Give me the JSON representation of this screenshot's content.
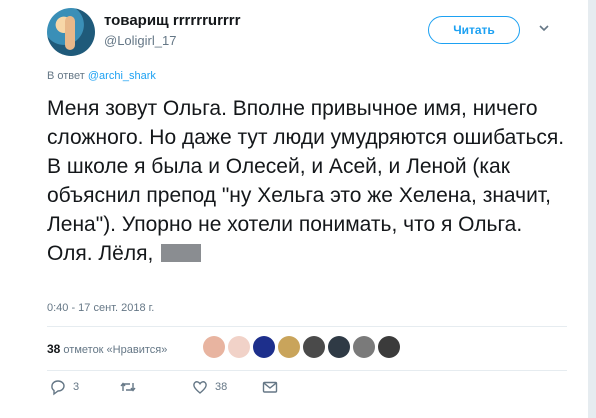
{
  "user": {
    "display_name": "товарищ rrrrrrurrrr",
    "handle": "@Loligirl_17"
  },
  "follow_button": {
    "label": "Читать"
  },
  "reply_to": {
    "prefix": "В ответ",
    "handle": "@archi_shark"
  },
  "tweet": {
    "text": "Меня зовут Ольга. Вполне привычное имя, ничего сложного. Но даже тут люди умудряются ошибаться. В школе я была и Олесей, и Асей, и Леной (как объяснил препод \"ну Хельга это же Хелена, значит, Лена\"). Упорно не хотели понимать, что я Ольга. Оля. Лёля, ",
    "timestamp": "0:40 - 17 сент. 2018 г."
  },
  "likes": {
    "count": "38",
    "label": "отметок «Нравится»"
  },
  "likers": [
    {
      "name": "liker-1",
      "color": "#e8b4a0"
    },
    {
      "name": "liker-2",
      "color": "#f1d2c8"
    },
    {
      "name": "liker-3",
      "color": "#1d2f8c"
    },
    {
      "name": "liker-4",
      "color": "#c9a45b"
    },
    {
      "name": "liker-5",
      "color": "#4a4a4a"
    },
    {
      "name": "liker-6",
      "color": "#2f3a45"
    },
    {
      "name": "liker-7",
      "color": "#7a7a7a"
    },
    {
      "name": "liker-8",
      "color": "#3b3b3b"
    }
  ],
  "actions": {
    "reply_count": "3",
    "retweet_count": "",
    "like_count": "38"
  },
  "colors": {
    "accent": "#1da1f2",
    "muted": "#657786",
    "text": "#14171a"
  }
}
